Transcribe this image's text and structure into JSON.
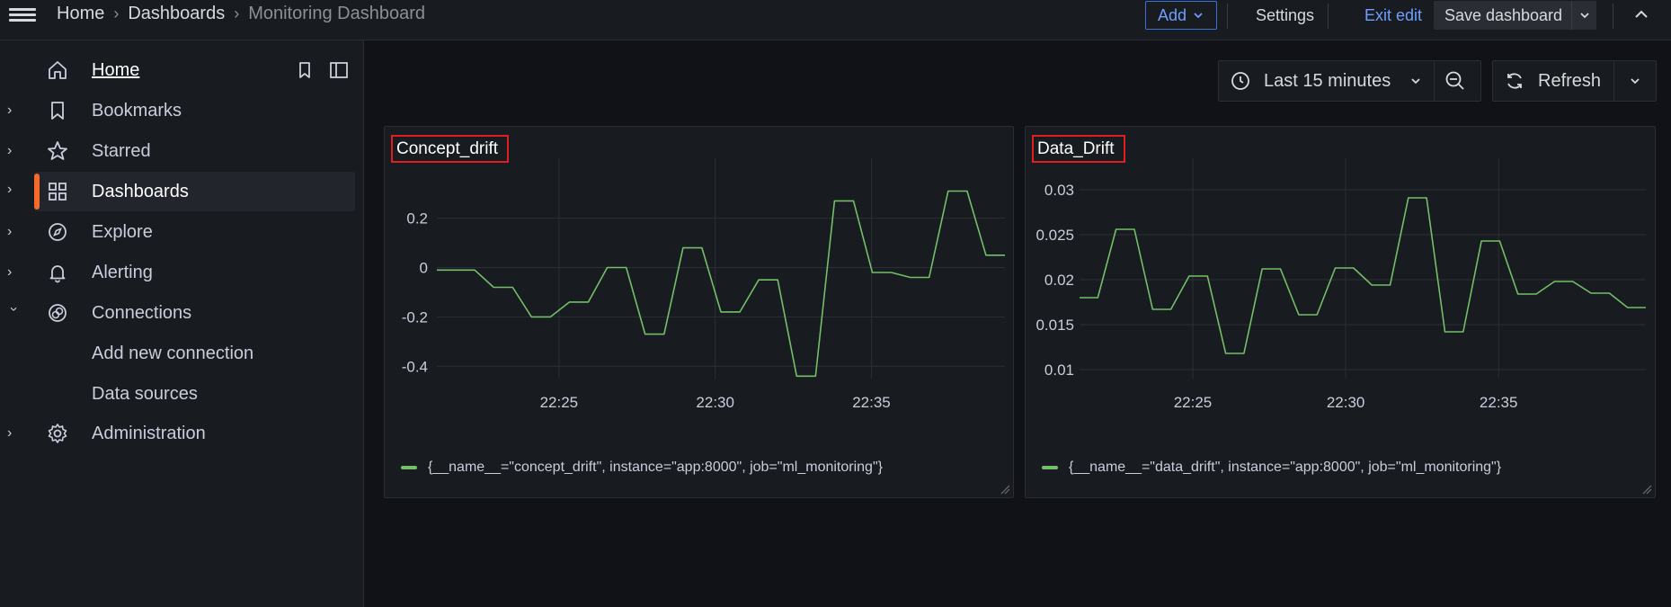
{
  "topbar": {
    "breadcrumb": [
      "Home",
      "Dashboards",
      "Monitoring Dashboard"
    ],
    "add_label": "Add",
    "settings_label": "Settings",
    "exit_edit_label": "Exit edit",
    "save_label": "Save dashboard"
  },
  "sidebar": {
    "items": [
      {
        "label": "Home",
        "icon": "home-icon"
      },
      {
        "label": "Bookmarks",
        "icon": "bookmark-icon"
      },
      {
        "label": "Starred",
        "icon": "star-icon"
      },
      {
        "label": "Dashboards",
        "icon": "dashboards-grid-icon"
      },
      {
        "label": "Explore",
        "icon": "compass-icon"
      },
      {
        "label": "Alerting",
        "icon": "bell-icon"
      },
      {
        "label": "Connections",
        "icon": "connections-icon"
      },
      {
        "label": "Add new connection",
        "icon": ""
      },
      {
        "label": "Data sources",
        "icon": ""
      },
      {
        "label": "Administration",
        "icon": "gear-icon"
      }
    ]
  },
  "toolbar": {
    "time_range": "Last 15 minutes",
    "refresh_label": "Refresh"
  },
  "colors": {
    "series": "#73bf69",
    "accent": "#f46a2b",
    "link": "#6e9fff",
    "highlight_box": "#e02020"
  },
  "chart_data": [
    {
      "type": "line",
      "title": "Concept_drift",
      "x_ticks": [
        "22:25",
        "22:30",
        "22:35"
      ],
      "y_ticks": [
        "0.2",
        "0",
        "-0.2",
        "-0.4"
      ],
      "ylim": [
        -0.45,
        0.37
      ],
      "legend": "{__name__=\"concept_drift\", instance=\"app:8000\", job=\"ml_monitoring\"}",
      "series": [
        {
          "values": [
            -0.01,
            -0.01,
            -0.01,
            -0.08,
            -0.08,
            -0.2,
            -0.2,
            -0.14,
            -0.14,
            0.0,
            0.0,
            -0.27,
            -0.27,
            0.08,
            0.08,
            -0.18,
            -0.18,
            -0.05,
            -0.05,
            -0.44,
            -0.44,
            0.27,
            0.27,
            -0.02,
            -0.02,
            -0.04,
            -0.04,
            0.31,
            0.31,
            0.05,
            0.05
          ]
        }
      ]
    },
    {
      "type": "line",
      "title": "Data_Drift",
      "x_ticks": [
        "22:25",
        "22:30",
        "22:35"
      ],
      "y_ticks": [
        "0.03",
        "0.025",
        "0.02",
        "0.015",
        "0.01"
      ],
      "ylim": [
        0.009,
        0.0315
      ],
      "legend": "{__name__=\"data_drift\", instance=\"app:8000\", job=\"ml_monitoring\"}",
      "series": [
        {
          "values": [
            0.018,
            0.018,
            0.0256,
            0.0256,
            0.0167,
            0.0167,
            0.0204,
            0.0204,
            0.0118,
            0.0118,
            0.0212,
            0.0212,
            0.0161,
            0.0161,
            0.0213,
            0.0213,
            0.0194,
            0.0194,
            0.0291,
            0.0291,
            0.0142,
            0.0142,
            0.0243,
            0.0243,
            0.0184,
            0.0184,
            0.0198,
            0.0198,
            0.0185,
            0.0185,
            0.0169,
            0.0169
          ]
        }
      ]
    }
  ]
}
